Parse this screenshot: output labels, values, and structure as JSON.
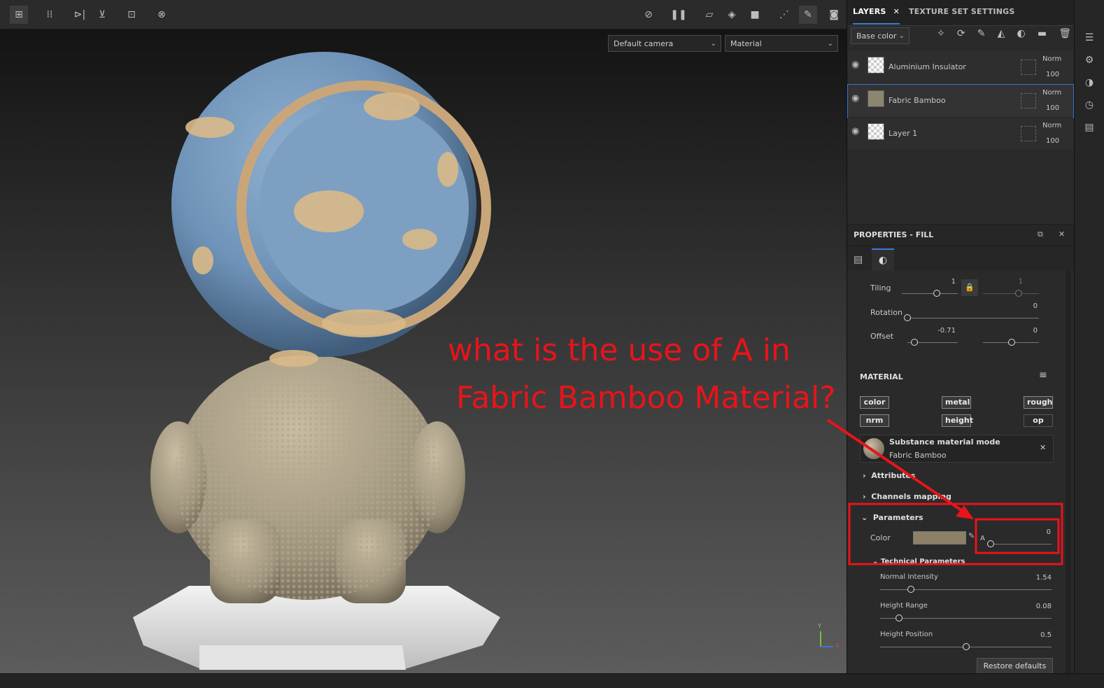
{
  "toolbar": {
    "icons": [
      "select-grid-icon",
      "grid-icon",
      "symmetry-x-icon",
      "symmetry-y-icon",
      "frame-icon",
      "reset-camera-icon",
      "hide-icon",
      "pause-icon",
      "projection-icon",
      "cube-icon",
      "camera-icon",
      "brush-options-icon",
      "paint-brush-icon",
      "screenshot-icon"
    ]
  },
  "viewport": {
    "camera_select": "Default camera",
    "mode_select": "Material",
    "axis_y": "Y",
    "axis_x": "X"
  },
  "layers_panel": {
    "tab_layers": "LAYERS",
    "tab_texture_set": "TEXTURE SET SETTINGS",
    "channel_select": "Base color",
    "layers": [
      {
        "name": "Aluminium Insulator",
        "blend": "Norm",
        "opacity": "100"
      },
      {
        "name": "Fabric Bamboo",
        "blend": "Norm",
        "opacity": "100"
      },
      {
        "name": "Layer 1",
        "blend": "Norm",
        "opacity": "100"
      }
    ]
  },
  "properties": {
    "title": "PROPERTIES - FILL",
    "tiling_label": "Tiling",
    "tiling_value": "1",
    "tiling_value2": "1",
    "rotation_label": "Rotation",
    "rotation_value": "0",
    "offset_label": "Offset",
    "offset_value": "-0.71",
    "offset_value2": "0",
    "material_label": "MATERIAL",
    "chips": [
      "color",
      "metal",
      "rough",
      "nrm",
      "height",
      "op"
    ],
    "substance_mode": "Substance material mode",
    "substance_name": "Fabric Bamboo",
    "attributes": "Attributes",
    "channels_mapping": "Channels mapping",
    "parameters": "Parameters",
    "color_label": "Color",
    "alpha_label": "A",
    "alpha_value": "0",
    "technical_parameters": "Technical Parameters",
    "normal_intensity_label": "Normal Intensity",
    "normal_intensity_value": "1.54",
    "height_range_label": "Height Range",
    "height_range_value": "0.08",
    "height_position_label": "Height Position",
    "height_position_value": "0.5",
    "restore_defaults": "Restore defaults",
    "color_swatch": "#8c8069"
  },
  "annotation": {
    "line1": "what is the use of A in",
    "line2": "Fabric Bamboo Material?",
    "color": "#e8141a"
  }
}
